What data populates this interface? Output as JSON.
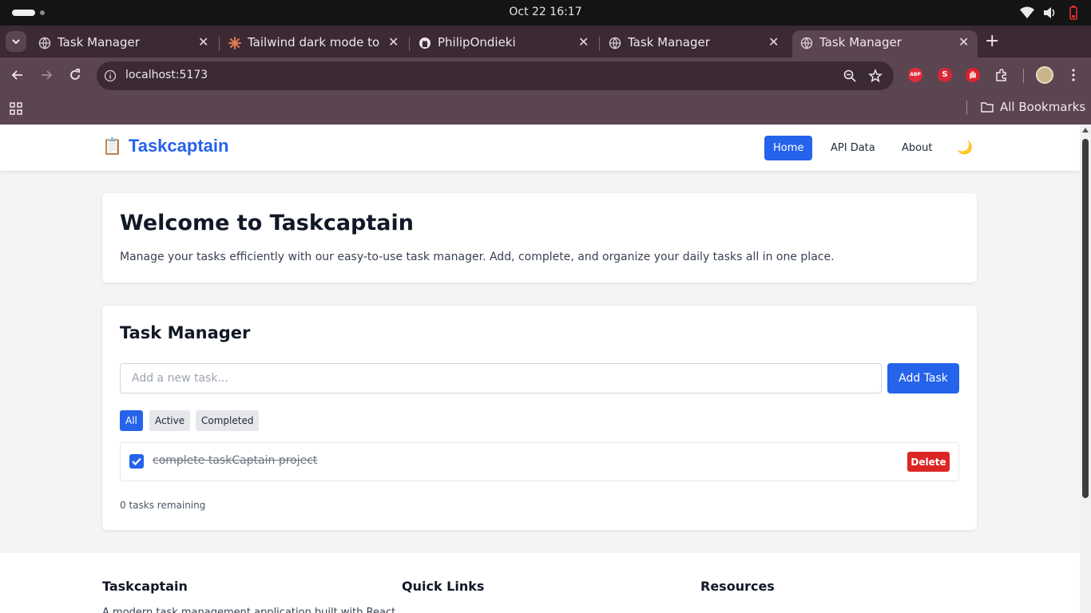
{
  "os": {
    "clock": "Oct 22  16:17"
  },
  "browser": {
    "tabs": [
      {
        "title": "Task Manager",
        "favicon": "globe-icon"
      },
      {
        "title": "Tailwind dark mode tog",
        "favicon": "claude-icon"
      },
      {
        "title": "PhilipOndieki",
        "favicon": "github-icon"
      },
      {
        "title": "Task Manager",
        "favicon": "globe-icon"
      },
      {
        "title": "Task Manager",
        "favicon": "globe-icon",
        "active": true
      }
    ],
    "url": "localhost:5173",
    "bookmarks_label": "All Bookmarks",
    "extensions": [
      "ABP",
      "S"
    ]
  },
  "app": {
    "brand": {
      "emoji": "📋",
      "name": "Taskcaptain"
    },
    "nav": {
      "home": "Home",
      "api": "API Data",
      "about": "About",
      "theme_icon": "🌙"
    },
    "welcome": {
      "title": "Welcome to Taskcaptain",
      "text": "Manage your tasks efficiently with our easy-to-use task manager. Add, complete, and organize your daily tasks all in one place."
    },
    "tasks": {
      "title": "Task Manager",
      "placeholder": "Add a new task...",
      "add_label": "Add Task",
      "filters": {
        "all": "All",
        "active": "Active",
        "completed": "Completed"
      },
      "items": [
        {
          "text": "complete taskCaptain project",
          "done": true,
          "delete_label": "Delete"
        }
      ],
      "remaining": "0 tasks remaining"
    },
    "footer": {
      "col1_title": "Taskcaptain",
      "col1_text": "A modern task management application built with React",
      "col2_title": "Quick Links",
      "col3_title": "Resources"
    }
  },
  "colors": {
    "primary": "#2563eb",
    "danger": "#dc2626",
    "chrome": "#5b4550",
    "tabstrip": "#3b2a33"
  }
}
